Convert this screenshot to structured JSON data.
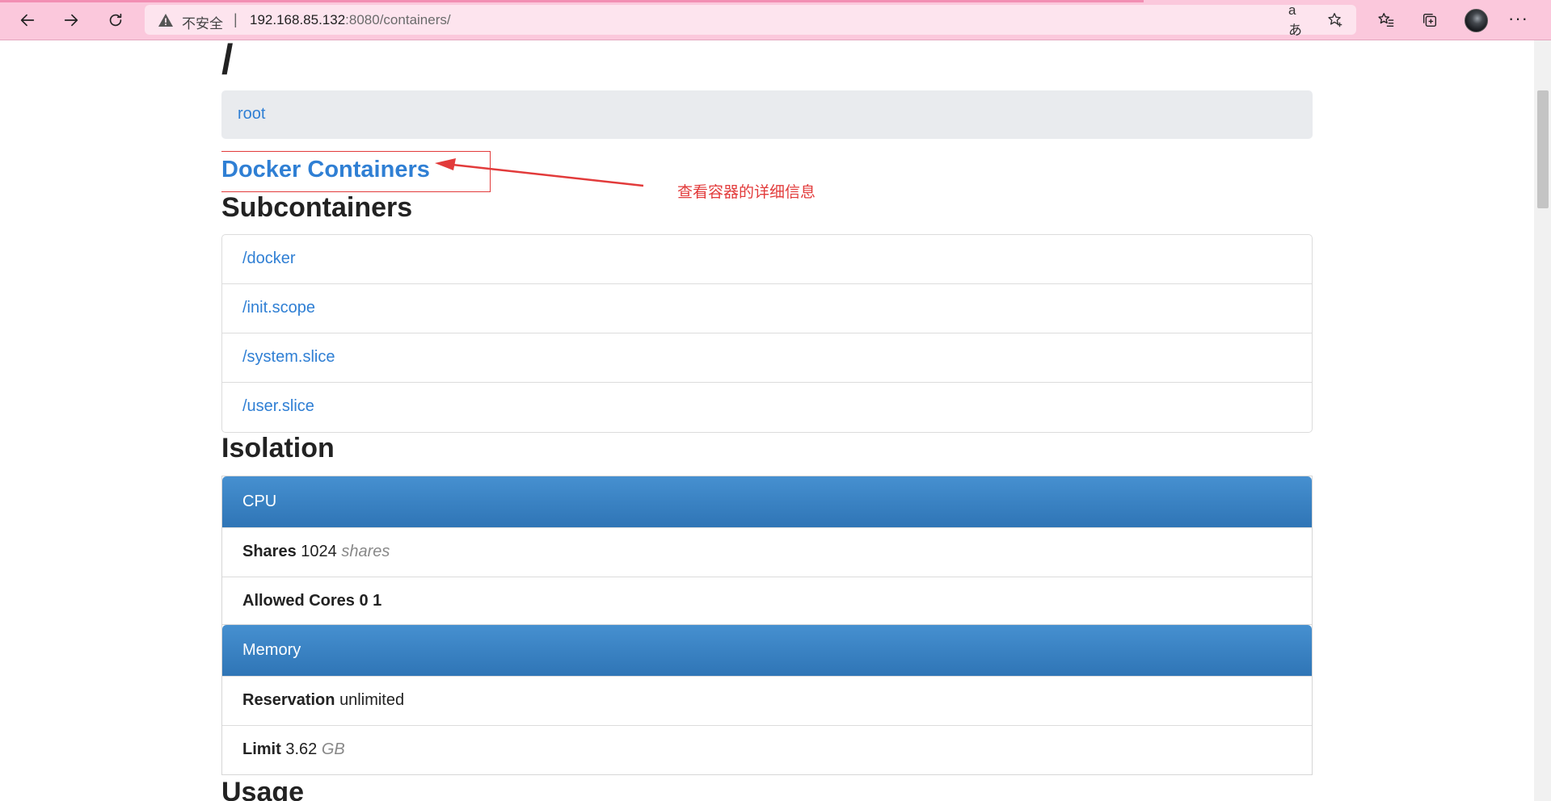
{
  "browser": {
    "security_label": "不安全",
    "url_host": "192.168.85.132",
    "url_rest": ":8080/containers/",
    "separator": "|",
    "translate_icon": "aあ"
  },
  "page": {
    "heading": "/",
    "breadcrumb_root": "root",
    "docker_link": "Docker Containers",
    "annotation": "查看容器的详细信息",
    "subcontainers_title": "Subcontainers",
    "subcontainers": [
      "/docker",
      "/init.scope",
      "/system.slice",
      "/user.slice"
    ],
    "isolation_title": "Isolation",
    "cpu": {
      "heading": "CPU",
      "shares_label": "Shares",
      "shares_value": "1024",
      "shares_unit": "shares",
      "cores_label": "Allowed Cores",
      "cores_value": "0 1"
    },
    "memory": {
      "heading": "Memory",
      "reservation_label": "Reservation",
      "reservation_value": "unlimited",
      "limit_label": "Limit",
      "limit_value": "3.62",
      "limit_unit": "GB"
    },
    "usage_title": "Usage"
  },
  "colors": {
    "link": "#2f7fd4",
    "annotation": "#e23b3b",
    "panel_heading": "#337ab7",
    "chrome": "#fbc8dc"
  }
}
